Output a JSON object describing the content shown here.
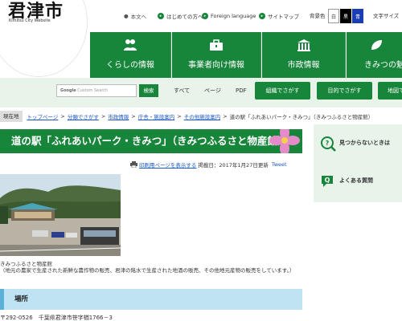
{
  "header": {
    "logo_title": "君津市",
    "logo_subtitle": "Kimitsu City Website",
    "utility": {
      "lang": "本文へ",
      "first_time": "はじめての方へ",
      "foreign": "Foreign language",
      "sitemap": "サイトマップ"
    },
    "bgcolor": {
      "label": "背景色",
      "white": "白",
      "black": "黒",
      "blue": "青"
    },
    "fontsize_label": "文字サイズ",
    "nav": [
      {
        "label": "くらしの情報",
        "icon": "people-icon"
      },
      {
        "label": "事業者向け情報",
        "icon": "briefcase-icon"
      },
      {
        "label": "市政情報",
        "icon": "building-icon"
      },
      {
        "label": "きみつの魅",
        "icon": "leaf-icon"
      }
    ]
  },
  "search": {
    "placeholder": "Custom Search",
    "button": "検索",
    "filters": [
      "すべて",
      "ページ",
      "PDF"
    ],
    "buttons": [
      "組織でさがす",
      "目的でさがす",
      "地図で"
    ]
  },
  "breadcrumb": {
    "current_label": "現在地",
    "links": [
      "トップページ",
      "分類でさがす",
      "市政情報",
      "庁舎・施設案内",
      "その他施設案内"
    ],
    "current": "道の駅「ふれあいパーク・きみつ」（きみつふるさと物産館）"
  },
  "main": {
    "title": "道の駅「ふれあいパーク・きみつ」（きみつふるさと物産館）",
    "print_link": "印刷用ページを表示する",
    "updated": "掲載日：2017年1月27日更新",
    "tweet": "Tweet",
    "photo_caption": "きみつふるさと物産館",
    "description": "（地元の農家で生産された新鮮な農作物の販売、君津の銘水で生産された地酒の販売、その他地元産物の販売をしています。）",
    "section_title": "場所",
    "address": "〒292-0526　千葉県君津市笹字楢1766－3"
  },
  "sidebar": {
    "not_found": "見つからないときは",
    "faq": "よくある質問"
  },
  "colors": {
    "brand_green": "#17853a",
    "light_green": "#e8f3e9",
    "section_blue": "#bfe3f2",
    "link_blue": "#1a56c4"
  }
}
